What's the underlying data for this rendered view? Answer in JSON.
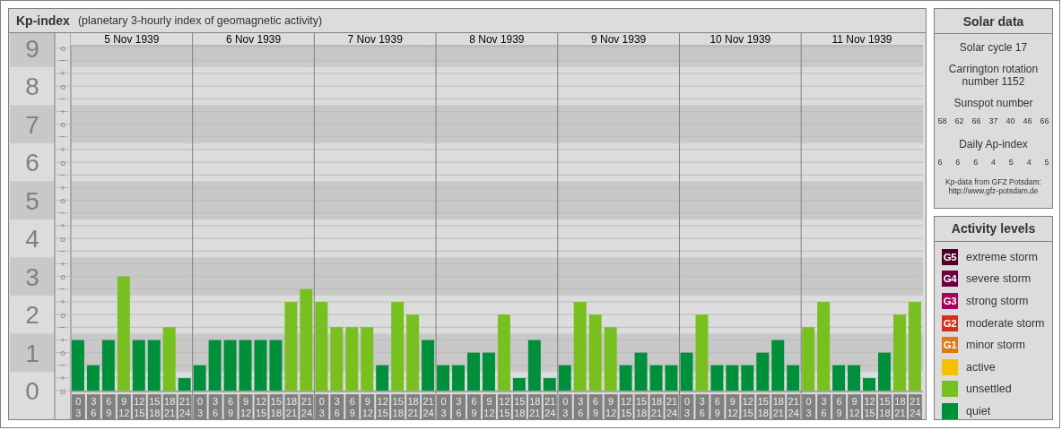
{
  "kp_panel": {
    "title": "Kp-index",
    "subtitle": "(planetary 3-hourly index of geomagnetic activity)",
    "days": [
      {
        "date": "5 Nov 1939",
        "slots": [
          {
            "from": "0",
            "to": "3"
          },
          {
            "from": "3",
            "to": "6"
          },
          {
            "from": "6",
            "to": "9"
          },
          {
            "from": "9",
            "to": "12"
          },
          {
            "from": "12",
            "to": "15"
          },
          {
            "from": "15",
            "to": "18"
          },
          {
            "from": "18",
            "to": "21"
          },
          {
            "from": "21",
            "to": "24"
          }
        ]
      },
      {
        "date": "6 Nov 1939",
        "slots": [
          {
            "from": "0",
            "to": "3"
          },
          {
            "from": "3",
            "to": "6"
          },
          {
            "from": "6",
            "to": "9"
          },
          {
            "from": "9",
            "to": "12"
          },
          {
            "from": "12",
            "to": "15"
          },
          {
            "from": "15",
            "to": "18"
          },
          {
            "from": "18",
            "to": "21"
          },
          {
            "from": "21",
            "to": "24"
          }
        ]
      },
      {
        "date": "7 Nov 1939",
        "slots": [
          {
            "from": "0",
            "to": "3"
          },
          {
            "from": "3",
            "to": "6"
          },
          {
            "from": "6",
            "to": "9"
          },
          {
            "from": "9",
            "to": "12"
          },
          {
            "from": "12",
            "to": "15"
          },
          {
            "from": "15",
            "to": "18"
          },
          {
            "from": "18",
            "to": "21"
          },
          {
            "from": "21",
            "to": "24"
          }
        ]
      },
      {
        "date": "8 Nov 1939",
        "slots": [
          {
            "from": "0",
            "to": "3"
          },
          {
            "from": "3",
            "to": "6"
          },
          {
            "from": "6",
            "to": "9"
          },
          {
            "from": "9",
            "to": "12"
          },
          {
            "from": "12",
            "to": "15"
          },
          {
            "from": "15",
            "to": "18"
          },
          {
            "from": "18",
            "to": "21"
          },
          {
            "from": "21",
            "to": "24"
          }
        ]
      },
      {
        "date": "9 Nov 1939",
        "slots": [
          {
            "from": "0",
            "to": "3"
          },
          {
            "from": "3",
            "to": "6"
          },
          {
            "from": "6",
            "to": "9"
          },
          {
            "from": "9",
            "to": "12"
          },
          {
            "from": "12",
            "to": "15"
          },
          {
            "from": "15",
            "to": "18"
          },
          {
            "from": "18",
            "to": "21"
          },
          {
            "from": "21",
            "to": "24"
          }
        ]
      },
      {
        "date": "10 Nov 1939",
        "slots": [
          {
            "from": "0",
            "to": "3"
          },
          {
            "from": "3",
            "to": "6"
          },
          {
            "from": "6",
            "to": "9"
          },
          {
            "from": "9",
            "to": "12"
          },
          {
            "from": "12",
            "to": "15"
          },
          {
            "from": "15",
            "to": "18"
          },
          {
            "from": "18",
            "to": "21"
          },
          {
            "from": "21",
            "to": "24"
          }
        ]
      },
      {
        "date": "11 Nov 1939",
        "slots": [
          {
            "from": "0",
            "to": "3"
          },
          {
            "from": "3",
            "to": "6"
          },
          {
            "from": "6",
            "to": "9"
          },
          {
            "from": "9",
            "to": "12"
          },
          {
            "from": "12",
            "to": "15"
          },
          {
            "from": "15",
            "to": "18"
          },
          {
            "from": "18",
            "to": "21"
          },
          {
            "from": "21",
            "to": "24"
          }
        ]
      }
    ],
    "scale_marks": [
      "o",
      "−",
      "+",
      "o",
      "−",
      "+",
      "o",
      "−",
      "+",
      "o",
      "−",
      "+",
      "o",
      "−",
      "+",
      "o",
      "−",
      "+",
      "o",
      "−",
      "+",
      "o",
      "−",
      "+",
      "o",
      "−",
      "+",
      "o"
    ],
    "chart_data": {
      "type": "bar",
      "ylim": [
        0,
        9
      ],
      "grid": true,
      "stacked": true,
      "bands": [
        {
          "axis": "y",
          "from": 0.5,
          "to": 1.5
        },
        {
          "axis": "y",
          "from": 2.5,
          "to": 3.5
        },
        {
          "axis": "y",
          "from": 4.5,
          "to": 5.5
        },
        {
          "axis": "y",
          "from": 6.5,
          "to": 7.5
        },
        {
          "axis": "y",
          "from": 8.5,
          "to": 9.5
        }
      ],
      "yticks": [
        {
          "value": 0,
          "label": "0"
        },
        {
          "value": 1,
          "label": "1"
        },
        {
          "value": 2,
          "label": "2"
        },
        {
          "value": 3,
          "label": "3"
        },
        {
          "value": 4,
          "label": "4"
        },
        {
          "value": 5,
          "label": "5"
        },
        {
          "value": 6,
          "label": "6"
        },
        {
          "value": 7,
          "label": "7"
        },
        {
          "value": 8,
          "label": "8"
        },
        {
          "value": 9,
          "label": "9"
        }
      ],
      "series": [
        {
          "color": "#00903c",
          "values": [
            1.33,
            0.67,
            1.33,
            null,
            1.33,
            1.33,
            null,
            0.33,
            0.67,
            1.33,
            1.33,
            1.33,
            1.33,
            1.33,
            null,
            null,
            null,
            null,
            null,
            null,
            0.67,
            null,
            null,
            1.33,
            0.67,
            0.67,
            1,
            1,
            null,
            0.33,
            1.33,
            0.33,
            0.67,
            null,
            null,
            null,
            0.67,
            1,
            0.67,
            0.67,
            1,
            null,
            0.67,
            0.67,
            0.67,
            1,
            1.33,
            0.67,
            null,
            null,
            0.67,
            0.67,
            0.33,
            1,
            null,
            null
          ]
        },
        {
          "color": "#78c020",
          "values": [
            null,
            null,
            null,
            3,
            null,
            null,
            1.67,
            null,
            null,
            null,
            null,
            null,
            null,
            null,
            2.33,
            2.67,
            2.33,
            1.67,
            1.67,
            1.67,
            null,
            2.33,
            2,
            null,
            null,
            null,
            null,
            null,
            2,
            null,
            null,
            null,
            null,
            2.33,
            2,
            1.67,
            null,
            null,
            null,
            null,
            null,
            2,
            null,
            null,
            null,
            null,
            null,
            null,
            1.67,
            2.33,
            null,
            null,
            null,
            null,
            2,
            2.33
          ]
        }
      ]
    }
  },
  "solar_data": {
    "title": "Solar data",
    "cycle": "Solar cycle 17",
    "rotation": "Carrington rotation number 1152",
    "sunspot_label": "Sunspot number",
    "sunspots": [
      "58",
      "62",
      "66",
      "37",
      "40",
      "46",
      "66"
    ],
    "ap_label": "Daily Ap-index",
    "ap_values": [
      "6",
      "6",
      "6",
      "4",
      "5",
      "4",
      "5"
    ],
    "credit_lines": [
      "Kp-data from GFZ Potsdam:",
      "http://www.gfz-potsdam.de"
    ]
  },
  "activity_levels": {
    "title": "Activity levels",
    "items": [
      {
        "badge": "G5",
        "label": "extreme storm",
        "color": "#4d0026"
      },
      {
        "badge": "G4",
        "label": "severe storm",
        "color": "#6b0040"
      },
      {
        "badge": "G3",
        "label": "strong storm",
        "color": "#a8005c"
      },
      {
        "badge": "G2",
        "label": "moderate storm",
        "color": "#d83018"
      },
      {
        "badge": "G1",
        "label": "minor storm",
        "color": "#e07818"
      },
      {
        "label": "active",
        "color": "#f8c000"
      },
      {
        "label": "unsettled",
        "color": "#78c020"
      },
      {
        "label": "quiet",
        "color": "#00903c"
      }
    ]
  }
}
